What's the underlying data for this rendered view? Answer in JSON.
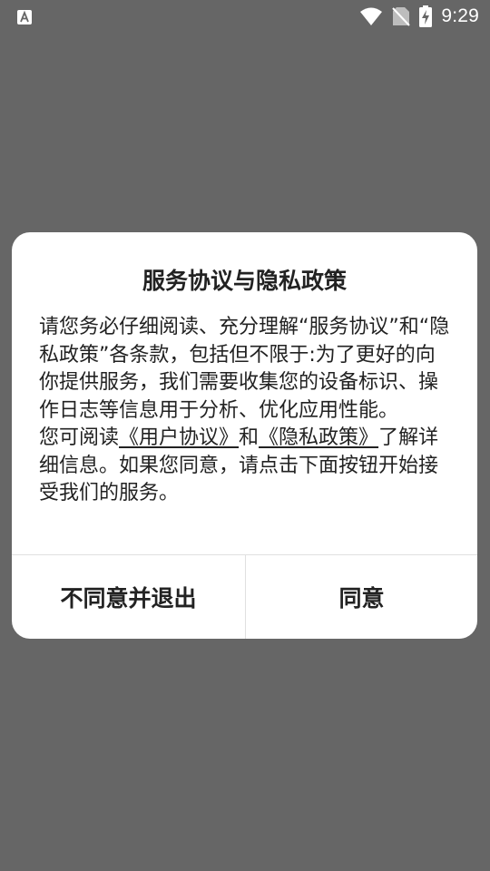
{
  "status_bar": {
    "time": "9:29",
    "icons": [
      "app-notification-icon",
      "wifi-icon",
      "no-sim-icon",
      "battery-charging-icon"
    ]
  },
  "dialog": {
    "title": "服务协议与隐私政策",
    "paragraph1": "请您务必仔细阅读、充分理解“服务协议”和“隐私政策”各条款，包括但不限于:为了更好的向你提供服务，我们需要收集您的设备标识、操作日志等信息用于分析、优化应用性能。",
    "paragraph2_prefix": "您可阅读",
    "user_agreement_link": "《用户协议》",
    "paragraph2_and": "和",
    "privacy_policy_link": "《隐私政策》",
    "paragraph2_suffix": "了解详细信息。如果您同意，请点击下面按钮开始接受我们的服务。",
    "disagree_button": "不同意并退出",
    "agree_button": "同意"
  },
  "colors": {
    "overlay": "#666666",
    "dialog_bg": "#ffffff",
    "text": "#222222",
    "divider": "#e0e0e0"
  }
}
